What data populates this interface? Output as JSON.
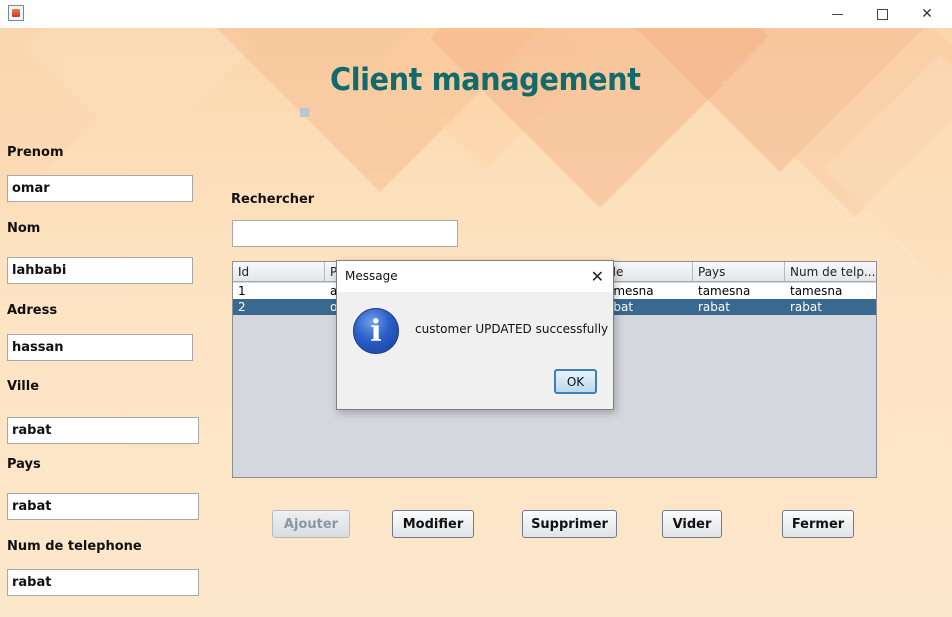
{
  "window": {
    "minimize_glyph": "",
    "close_glyph": "✕"
  },
  "header": {
    "title": "Client management"
  },
  "form": {
    "prenom_label": "Prenom",
    "prenom_value": "omar",
    "nom_label": "Nom",
    "nom_value": "lahbabi",
    "adress_label": "Adress",
    "adress_value": "hassan",
    "ville_label": "Ville",
    "ville_value": "rabat",
    "pays_label": "Pays",
    "pays_value": "rabat",
    "tel_label": "Num de telephone",
    "tel_value": "rabat"
  },
  "search": {
    "label": "Rechercher",
    "value": ""
  },
  "table": {
    "headers": [
      "Id",
      "P",
      "",
      "ille",
      "Pays",
      "Num de telp..."
    ],
    "rows": [
      [
        "1",
        "a",
        "",
        "amesna",
        "tamesna",
        "tamesna"
      ],
      [
        "2",
        "o",
        "",
        "abat",
        "rabat",
        "rabat"
      ]
    ],
    "selected_row": 2
  },
  "buttons": {
    "ajouter": "Ajouter",
    "modifier": "Modifier",
    "supprimer": "Supprimer",
    "vider": "Vider",
    "fermer": "Fermer"
  },
  "dialog": {
    "title": "Message",
    "close_glyph": "✕",
    "icon_glyph": "i",
    "message": "customer UPDATED successfully",
    "ok_label": "OK"
  },
  "colors": {
    "title_color": "#126b6b",
    "selected_row": "#39698f",
    "background": "#fde3c2"
  },
  "icons": [
    "java-app-icon",
    "minimize-icon",
    "maximize-icon",
    "close-icon",
    "info-icon"
  ]
}
